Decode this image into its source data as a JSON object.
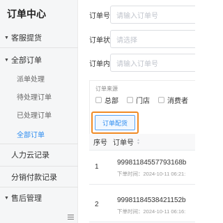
{
  "sidebar": {
    "title": "订单中心",
    "items": [
      {
        "label": "客服提货",
        "caret": "▼"
      },
      {
        "label": "全部订单",
        "caret": "▼"
      },
      {
        "label": "派单处理"
      },
      {
        "label": "待处理订单"
      },
      {
        "label": "已处理订单"
      },
      {
        "label": "全部订单",
        "active": true
      },
      {
        "label": "人力云记录"
      },
      {
        "label": "分销付款记录"
      },
      {
        "label": "售后管理",
        "caret": "▼"
      }
    ],
    "collapse_icon": "menu-icon"
  },
  "filters": {
    "order_no": {
      "label": "订单号",
      "placeholder": "请输入订单号"
    },
    "order_status": {
      "label": "订单状态",
      "placeholder": "请选择"
    },
    "order_content": {
      "label": "订单内容",
      "placeholder": "请输入订单号"
    }
  },
  "source": {
    "title": "订单来源",
    "options": [
      "总部",
      "门店",
      "消费者"
    ]
  },
  "dispatch_button": "订单配货",
  "table": {
    "columns": [
      "序号",
      "订单号"
    ],
    "rows": [
      {
        "seq": "1",
        "order_no": "99981184557793168b",
        "time": "下单时间：2024-10-11 06:21:"
      },
      {
        "seq": "2",
        "order_no": "99981184538421152b",
        "time": "下单时间：2024-10-11 06:16:"
      }
    ]
  },
  "colors": {
    "accent": "#2d8cf0",
    "highlight": "#f08a24",
    "sidebar_bg": "#f5f6f7"
  }
}
